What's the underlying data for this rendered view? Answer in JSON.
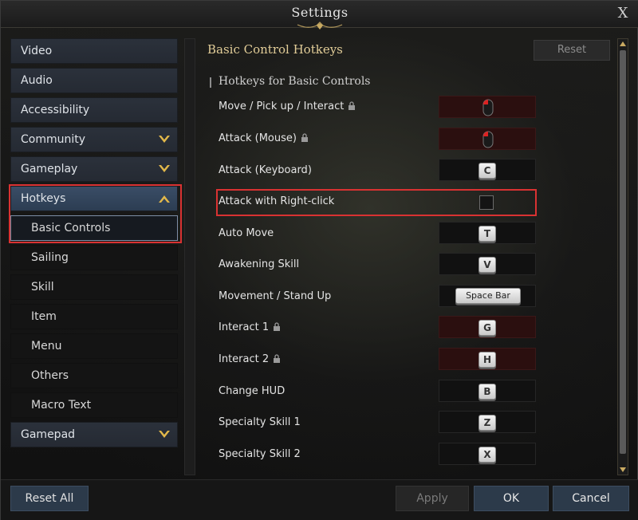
{
  "window": {
    "title": "Settings",
    "close_label": "X"
  },
  "sidebar": {
    "items": [
      {
        "label": "Video"
      },
      {
        "label": "Audio"
      },
      {
        "label": "Accessibility"
      },
      {
        "label": "Community"
      },
      {
        "label": "Gameplay"
      },
      {
        "label": "Hotkeys"
      },
      {
        "label": "Basic Controls"
      },
      {
        "label": "Sailing"
      },
      {
        "label": "Skill"
      },
      {
        "label": "Item"
      },
      {
        "label": "Menu"
      },
      {
        "label": "Others"
      },
      {
        "label": "Macro Text"
      },
      {
        "label": "Gamepad"
      }
    ],
    "active_category": "Hotkeys",
    "selected_subitem": "Basic Controls"
  },
  "panel": {
    "title": "Basic Control Hotkeys",
    "reset_label": "Reset",
    "section_title": "Hotkeys for Basic Controls",
    "rows": [
      {
        "label": "Move / Pick up / Interact",
        "locked": true,
        "binding": "mouse-left-icon"
      },
      {
        "label": "Attack (Mouse)",
        "locked": true,
        "binding": "mouse-left-icon"
      },
      {
        "label": "Attack (Keyboard)",
        "locked": false,
        "key": "C"
      },
      {
        "label": "Attack with Right-click",
        "locked": false,
        "checkbox": false
      },
      {
        "label": "Auto Move",
        "locked": false,
        "key": "T"
      },
      {
        "label": "Awakening Skill",
        "locked": false,
        "key": "V"
      },
      {
        "label": "Movement / Stand Up",
        "locked": false,
        "key": "Space Bar"
      },
      {
        "label": "Interact 1",
        "locked": true,
        "key": "G"
      },
      {
        "label": "Interact 2",
        "locked": true,
        "key": "H"
      },
      {
        "label": "Change HUD",
        "locked": false,
        "key": "B"
      },
      {
        "label": "Specialty Skill 1",
        "locked": false,
        "key": "Z"
      },
      {
        "label": "Specialty Skill 2",
        "locked": false,
        "key": "X"
      }
    ]
  },
  "footer": {
    "reset_all_label": "Reset All",
    "apply_label": "Apply",
    "ok_label": "OK",
    "cancel_label": "Cancel"
  },
  "colors": {
    "accent_gold": "#e2cd98",
    "highlight_red": "#d93232",
    "locked_slot": "#2b0f0f"
  }
}
